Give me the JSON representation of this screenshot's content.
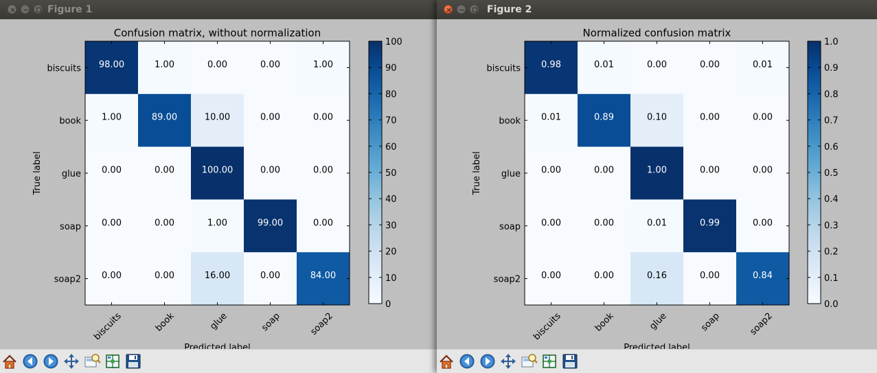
{
  "windows": [
    {
      "title": "Figure 1",
      "active": false,
      "chart_data": {
        "type": "heatmap",
        "title": "Confusion matrix, without normalization",
        "xlabel": "Predicted label",
        "ylabel": "True label",
        "x_categories": [
          "biscuits",
          "book",
          "glue",
          "soap",
          "soap2"
        ],
        "y_categories": [
          "biscuits",
          "book",
          "glue",
          "soap",
          "soap2"
        ],
        "cell_labels": [
          [
            "98.00",
            "1.00",
            "0.00",
            "0.00",
            "1.00"
          ],
          [
            "1.00",
            "89.00",
            "10.00",
            "0.00",
            "0.00"
          ],
          [
            "0.00",
            "0.00",
            "100.00",
            "0.00",
            "0.00"
          ],
          [
            "0.00",
            "0.00",
            "1.00",
            "99.00",
            "0.00"
          ],
          [
            "0.00",
            "0.00",
            "16.00",
            "0.00",
            "84.00"
          ]
        ],
        "values": [
          [
            98,
            1,
            0,
            0,
            1
          ],
          [
            1,
            89,
            10,
            0,
            0
          ],
          [
            0,
            0,
            100,
            0,
            0
          ],
          [
            0,
            0,
            1,
            99,
            0
          ],
          [
            0,
            0,
            16,
            0,
            84
          ]
        ],
        "colormap": "Blues",
        "vmin": 0,
        "vmax": 100,
        "colorbar_ticks": [
          "0",
          "10",
          "20",
          "30",
          "40",
          "50",
          "60",
          "70",
          "80",
          "90",
          "100"
        ]
      }
    },
    {
      "title": "Figure 2",
      "active": true,
      "chart_data": {
        "type": "heatmap",
        "title": "Normalized confusion matrix",
        "xlabel": "Predicted label",
        "ylabel": "True label",
        "x_categories": [
          "biscuits",
          "book",
          "glue",
          "soap",
          "soap2"
        ],
        "y_categories": [
          "biscuits",
          "book",
          "glue",
          "soap",
          "soap2"
        ],
        "cell_labels": [
          [
            "0.98",
            "0.01",
            "0.00",
            "0.00",
            "0.01"
          ],
          [
            "0.01",
            "0.89",
            "0.10",
            "0.00",
            "0.00"
          ],
          [
            "0.00",
            "0.00",
            "1.00",
            "0.00",
            "0.00"
          ],
          [
            "0.00",
            "0.00",
            "0.01",
            "0.99",
            "0.00"
          ],
          [
            "0.00",
            "0.00",
            "0.16",
            "0.00",
            "0.84"
          ]
        ],
        "values": [
          [
            0.98,
            0.01,
            0,
            0,
            0.01
          ],
          [
            0.01,
            0.89,
            0.1,
            0,
            0
          ],
          [
            0,
            0,
            1.0,
            0,
            0
          ],
          [
            0,
            0,
            0.01,
            0.99,
            0
          ],
          [
            0,
            0,
            0.16,
            0,
            0.84
          ]
        ],
        "colormap": "Blues",
        "vmin": 0,
        "vmax": 1,
        "colorbar_ticks": [
          "0.0",
          "0.1",
          "0.2",
          "0.3",
          "0.4",
          "0.5",
          "0.6",
          "0.7",
          "0.8",
          "0.9",
          "1.0"
        ]
      }
    }
  ],
  "toolbar_buttons": [
    {
      "name": "home-button",
      "icon": "home-icon"
    },
    {
      "name": "back-button",
      "icon": "back-arrow-icon"
    },
    {
      "name": "forward-button",
      "icon": "forward-arrow-icon"
    },
    {
      "name": "pan-button",
      "icon": "move-icon"
    },
    {
      "name": "zoom-button",
      "icon": "zoom-rect-icon"
    },
    {
      "name": "subplots-button",
      "icon": "subplots-icon"
    },
    {
      "name": "save-button",
      "icon": "floppy-disk-icon"
    }
  ]
}
